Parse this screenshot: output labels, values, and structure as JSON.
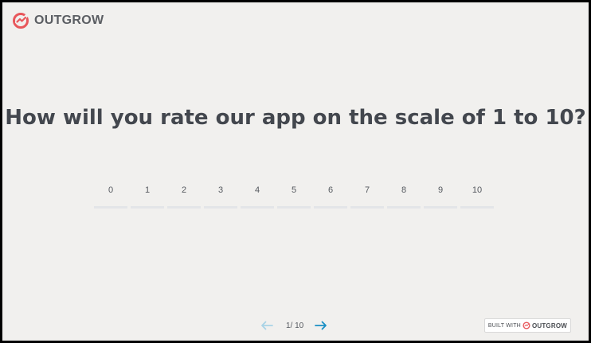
{
  "brand": {
    "name": "OUTGROW",
    "accent_color": "#e8575b"
  },
  "question": {
    "text": "How will you rate our app on the scale of 1 to 10?"
  },
  "scale": {
    "options": [
      "0",
      "1",
      "2",
      "3",
      "4",
      "5",
      "6",
      "7",
      "8",
      "9",
      "10"
    ]
  },
  "pagination": {
    "label": "1/ 10",
    "prev_icon": "arrow-left-icon",
    "next_icon": "arrow-right-icon",
    "prev_color": "#a9d3e6",
    "next_color": "#1a8fc4"
  },
  "badge": {
    "prefix": "BUILT WITH",
    "brand": "OUTGROW"
  }
}
